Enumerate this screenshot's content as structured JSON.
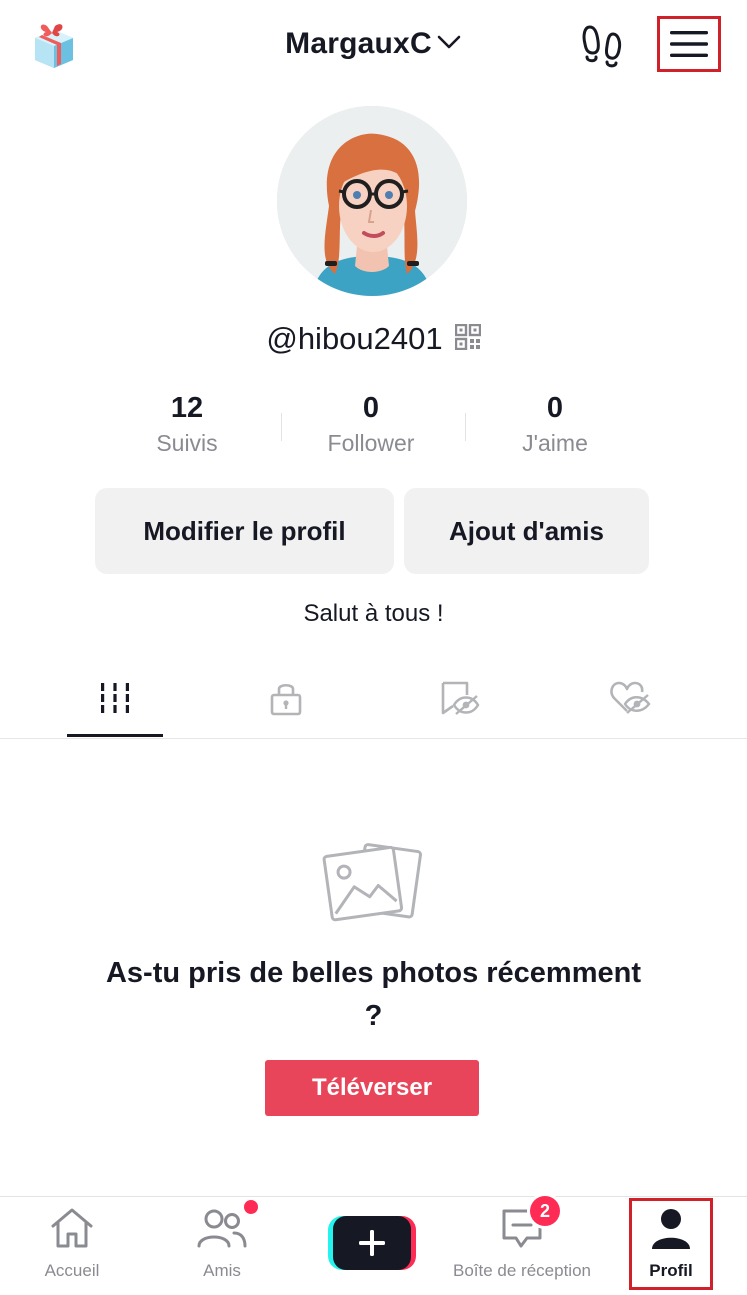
{
  "header": {
    "username": "MargauxC",
    "icons": {
      "gift": "gift-icon",
      "dropdown": "chevron-down-icon",
      "footprint": "footprint-icon",
      "menu": "hamburger-menu-icon"
    }
  },
  "profile": {
    "handle": "@hibou2401",
    "bio": "Salut à tous !",
    "stats": [
      {
        "value": "12",
        "label": "Suivis"
      },
      {
        "value": "0",
        "label": "Follower"
      },
      {
        "value": "0",
        "label": "J'aime"
      }
    ],
    "buttons": {
      "edit": "Modifier le profil",
      "add_friends": "Ajout d'amis"
    }
  },
  "tabs": [
    {
      "icon": "grid-icon",
      "active": true
    },
    {
      "icon": "lock-icon",
      "active": false
    },
    {
      "icon": "bookmark-hidden-icon",
      "active": false
    },
    {
      "icon": "heart-hidden-icon",
      "active": false
    }
  ],
  "empty_state": {
    "title": "As-tu pris de belles photos récemment ?",
    "button": "Téléverser"
  },
  "bottom_nav": {
    "items": [
      {
        "label": "Accueil",
        "icon": "home-icon"
      },
      {
        "label": "Amis",
        "icon": "friends-icon",
        "dot": true
      },
      {
        "label": "",
        "icon": "plus-icon"
      },
      {
        "label": "Boîte de réception",
        "icon": "inbox-icon",
        "badge": "2"
      },
      {
        "label": "Profil",
        "icon": "profile-icon",
        "active": true
      }
    ]
  },
  "colors": {
    "accent": "#fe2c55",
    "upload_button": "#e8455a",
    "highlight_box": "#d0202a",
    "text_primary": "#161823",
    "text_secondary": "#8a8b91",
    "button_bg": "#f1f1f2"
  }
}
